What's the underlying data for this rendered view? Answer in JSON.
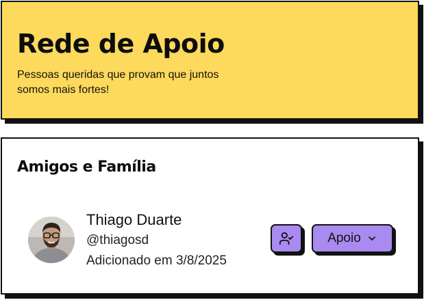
{
  "hero": {
    "title": "Rede de Apoio",
    "subtitle": "Pessoas queridas que provam que juntos somos mais fortes!"
  },
  "card": {
    "title": "Amigos e Família",
    "contacts": [
      {
        "name": "Thiago Duarte",
        "handle": "@thiagosd",
        "added": "Adicionado em 3/8/2025",
        "avatar_icon": "avatar-photo",
        "actions": {
          "friend_icon": "user-check-icon",
          "dropdown_label": "Apoio",
          "dropdown_icon": "chevron-down-icon"
        }
      }
    ]
  },
  "colors": {
    "hero_bg": "#fdd95c",
    "accent": "#a98af0",
    "border": "#111111"
  }
}
